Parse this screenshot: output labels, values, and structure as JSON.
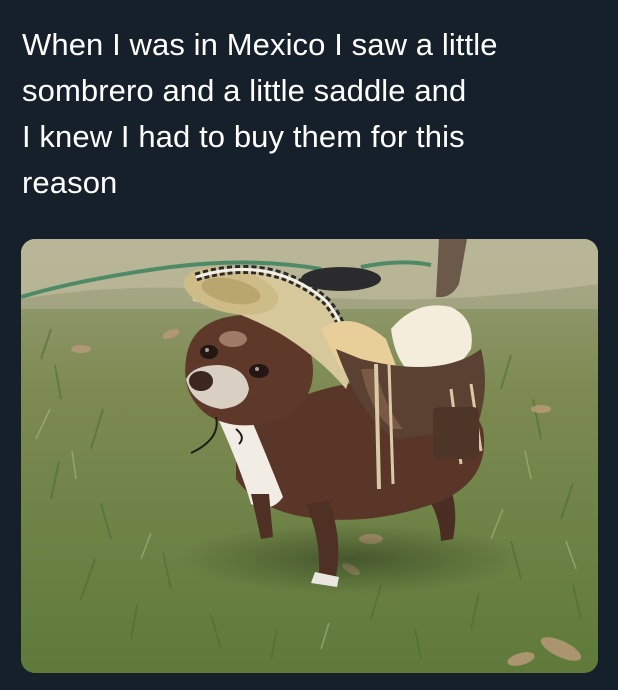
{
  "tweet": {
    "text": "When I was in Mexico I saw a little\nsombrero and a little saddle and\nI knew I had to buy them for this\nreason"
  },
  "media": {
    "subject_icon": "chihuahua-photo",
    "colors": {
      "background": "#15202b",
      "text": "#ffffff"
    }
  }
}
